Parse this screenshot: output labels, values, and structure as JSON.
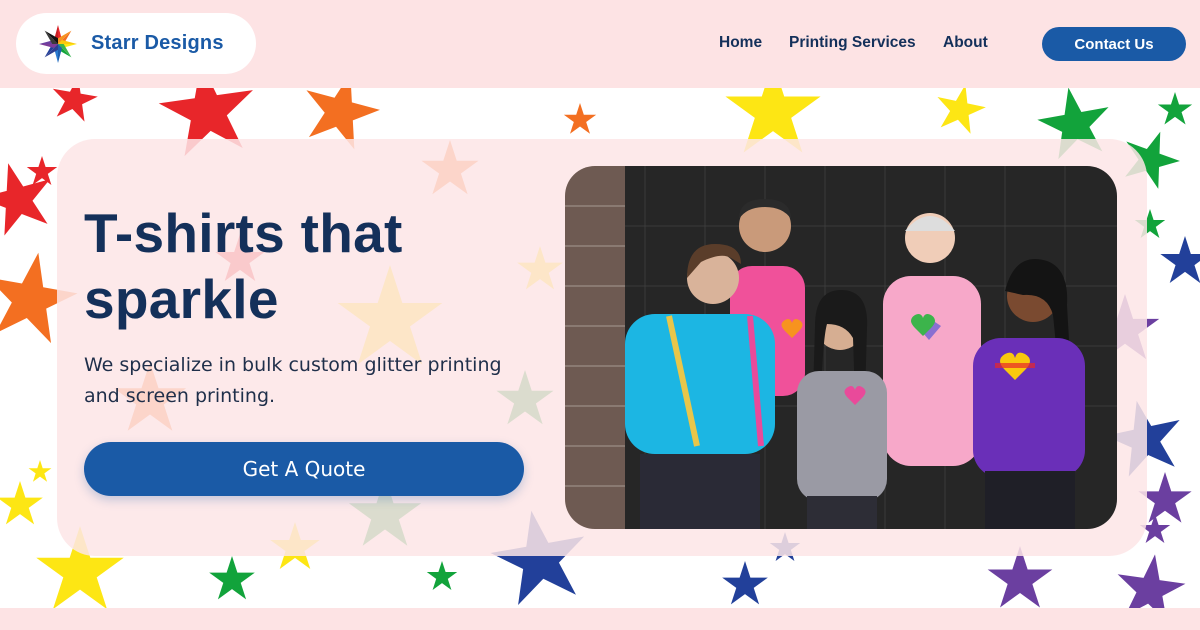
{
  "header": {
    "brand": "Starr Designs",
    "logo_icon": "rainbow-star-icon",
    "nav": {
      "home": "Home",
      "printing": "Printing Services",
      "about": "About"
    },
    "contact_label": "Contact Us"
  },
  "hero": {
    "title": "T-shirts that sparkle",
    "subtitle": "We specialize in bulk custom glitter printing and screen printing.",
    "cta_label": "Get A Quote",
    "photo_icon": "group-photo-image"
  },
  "colors": {
    "brand_blue": "#1a5aa6",
    "navy_text": "#14305a",
    "header_pink": "#fde3e4",
    "star_red": "#e8262a",
    "star_orange": "#f36f21",
    "star_yellow": "#fde614",
    "star_green": "#12a33b",
    "star_blue": "#22409a",
    "star_purple": "#6b3fa0"
  }
}
